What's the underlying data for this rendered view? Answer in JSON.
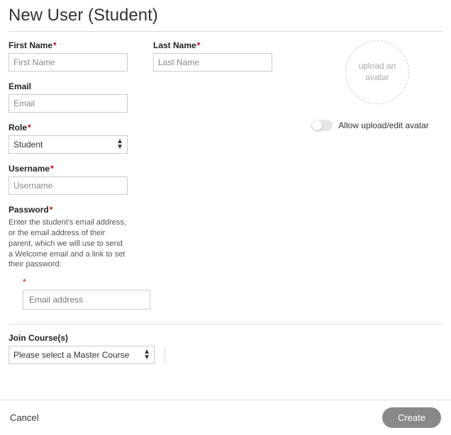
{
  "title": "New User (Student)",
  "fields": {
    "first_name": {
      "label": "First Name",
      "placeholder": "First Name",
      "required": true
    },
    "last_name": {
      "label": "Last Name",
      "placeholder": "Last Name",
      "required": true
    },
    "email": {
      "label": "Email",
      "placeholder": "Email",
      "required": false
    },
    "role": {
      "label": "Role",
      "required": true,
      "selected": "Student"
    },
    "username": {
      "label": "Username",
      "placeholder": "Username",
      "required": true
    },
    "password": {
      "label": "Password",
      "required": true,
      "helper": "Enter the student's email address, or the email address of their parent, which we will use to send a Welcome email and a link to set their password:",
      "placeholder": "Email address"
    }
  },
  "avatar": {
    "placeholder_text": "upload an avatar",
    "toggle_label": "Allow upload/edit avatar"
  },
  "join": {
    "label": "Join Course(s)",
    "placeholder": "Please select a Master Course"
  },
  "footer": {
    "cancel": "Cancel",
    "create": "Create"
  },
  "req_mark": "*"
}
